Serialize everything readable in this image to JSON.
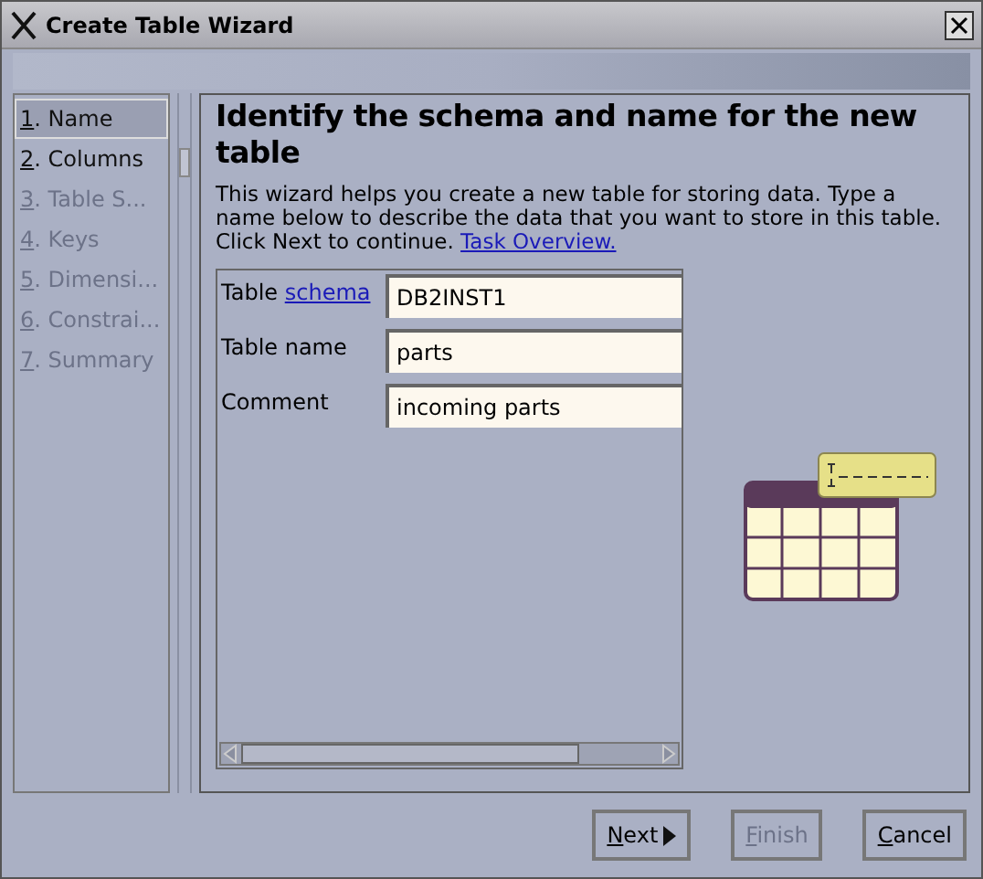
{
  "window": {
    "title": "Create Table Wizard"
  },
  "steps": [
    {
      "number": "1.",
      "label": "Name",
      "selected": true,
      "disabled": false
    },
    {
      "number": "2.",
      "label": "Columns",
      "selected": false,
      "disabled": false
    },
    {
      "number": "3.",
      "label": "Table S...",
      "selected": false,
      "disabled": true
    },
    {
      "number": "4.",
      "label": "Keys",
      "selected": false,
      "disabled": true
    },
    {
      "number": "5.",
      "label": "Dimensi...",
      "selected": false,
      "disabled": true
    },
    {
      "number": "6.",
      "label": "Constrai...",
      "selected": false,
      "disabled": true
    },
    {
      "number": "7.",
      "label": "Summary",
      "selected": false,
      "disabled": true
    }
  ],
  "heading": "Identify the schema and name for the new table",
  "intro": "This wizard helps you create a new table for storing data. Type a name below to describe the data that you want to store in this table. Click Next to continue.",
  "intro_link": "Task Overview.",
  "fields": [
    {
      "label": "Table",
      "link": "schema",
      "value": "DB2INST1"
    },
    {
      "label": "Table name",
      "value": "parts"
    },
    {
      "label": "Comment",
      "value": "incoming parts"
    }
  ],
  "buttons": [
    {
      "label": "Next",
      "kind": "next",
      "disabled": false
    },
    {
      "label": "Finish",
      "kind": "plain",
      "disabled": true
    },
    {
      "label": "Cancel",
      "kind": "plain",
      "disabled": false
    }
  ]
}
